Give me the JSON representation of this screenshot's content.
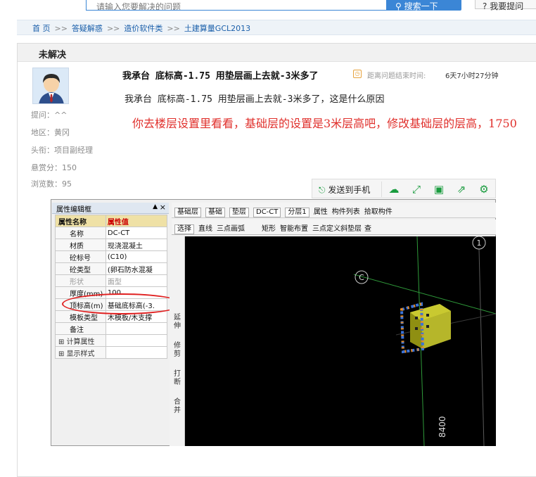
{
  "search": {
    "placeholder": "请输入您要解决的问题",
    "button": "搜索一下",
    "ask_button": "我要提问"
  },
  "breadcrumb": {
    "items": [
      "首 页",
      "答疑解惑",
      "造价软件类",
      "土建算量GCL2013"
    ],
    "separator": ">>"
  },
  "status": "未解决",
  "asker": {
    "asker_label": "提问：",
    "asker_value": "^^",
    "region_label": "地区：",
    "region_value": "黄冈",
    "rank_label": "头衔：",
    "rank_value": "项目副经理",
    "reward_label": "悬赏分：",
    "reward_value": "150",
    "views_label": "浏览数：",
    "views_value": "95"
  },
  "question": {
    "title": "我承台 底标高-1.75 用垫层画上去就-3米多了",
    "timer_label": "距离问题结束时间:",
    "timer_value": "6天7小时27分钟",
    "body": "我承台 底标高-1.75 用垫层画上去就-3米多了，这是什么原因"
  },
  "answer": {
    "text": "你去楼层设置里看看，基础层的设置是3米层高吧，修改基础层的层高，1750"
  },
  "share_toolbar": {
    "send_label": "发送到手机"
  },
  "screenshot": {
    "prop_panel_title": "属性编辑框",
    "prop_header": [
      "属性名称",
      "属性值"
    ],
    "props": [
      {
        "name": "名称",
        "value": "DC-CT"
      },
      {
        "name": "材质",
        "value": "现浇混凝土"
      },
      {
        "name": "砼标号",
        "value": "(C10)"
      },
      {
        "name": "砼类型",
        "value": "(卵石防水混凝"
      },
      {
        "name": "形状",
        "value": "面型"
      },
      {
        "name": "厚度(mm)",
        "value": "100"
      },
      {
        "name": "顶标高(m)",
        "value": "基础底标高(-3."
      },
      {
        "name": "模板类型",
        "value": "木模板/木支撑"
      },
      {
        "name": "备注",
        "value": ""
      }
    ],
    "groups": [
      "计算属性",
      "显示样式"
    ],
    "ribbon1": {
      "layer": "基础层",
      "type": "基础",
      "element": "垫层",
      "code": "DC-CT",
      "floor": "分层1",
      "btn_props": "属性",
      "btn_list": "构件列表",
      "btn_pick": "拾取构件"
    },
    "ribbon2": {
      "select": "选择",
      "line": "直线",
      "arc": "三点画弧",
      "rect": "矩形",
      "smart": "智能布置",
      "slope": "三点定义斜垫层",
      "check": "查"
    },
    "vtools": [
      "延伸",
      "修剪",
      "打断",
      "合并"
    ],
    "canvas_labels": {
      "axis_c": "C",
      "axis_1": "1",
      "dimension": "8400"
    }
  }
}
